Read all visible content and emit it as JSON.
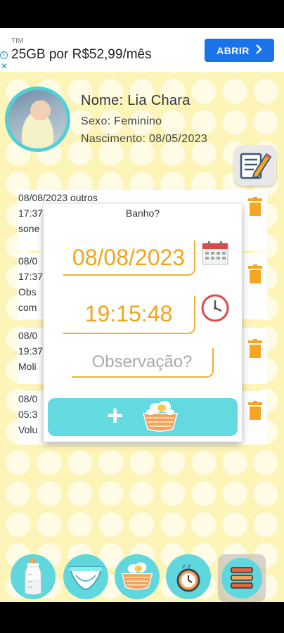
{
  "ad": {
    "brand": "TIM",
    "text": "25GB por R$52,99/mês",
    "button_label": "ABRIR",
    "button_icon": "chevron-right-icon",
    "info_icon": "info-icon",
    "close_icon": "close-icon"
  },
  "profile": {
    "name_line": "Nome: Lia Chara",
    "sex_line": "Sexo: Feminino",
    "birth_line": "Nascimento: 08/05/2023",
    "edit_icon": "edit-note-icon"
  },
  "records": [
    {
      "lines": [
        "08/08/2023 outros",
        "17:37",
        "sone"
      ]
    },
    {
      "lines": [
        "08/0",
        "17:37",
        "Obs",
        "com"
      ]
    },
    {
      "lines": [
        "08/0",
        "19:37",
        "Moli"
      ]
    },
    {
      "lines": [
        "08/0",
        "05:3",
        "Volu"
      ]
    }
  ],
  "dialog": {
    "title": "Banho?",
    "date_value": "08/08/2023",
    "time_value": "19:15:48",
    "observation_placeholder": "Observação?",
    "calendar_icon": "calendar-icon",
    "clock_icon": "clock-icon",
    "add_icon": "plus-icon",
    "bath_icon": "bath-tub-icon"
  },
  "bottom_nav": [
    {
      "icon": "bottle-icon"
    },
    {
      "icon": "diaper-icon"
    },
    {
      "icon": "bath-tub-icon"
    },
    {
      "icon": "sleep-clock-icon"
    },
    {
      "icon": "menu-icon"
    }
  ],
  "colors": {
    "accent": "#5fd7dd",
    "field_text": "#f2a51c",
    "background": "#fdf4b8",
    "trash": "#f5a623"
  }
}
